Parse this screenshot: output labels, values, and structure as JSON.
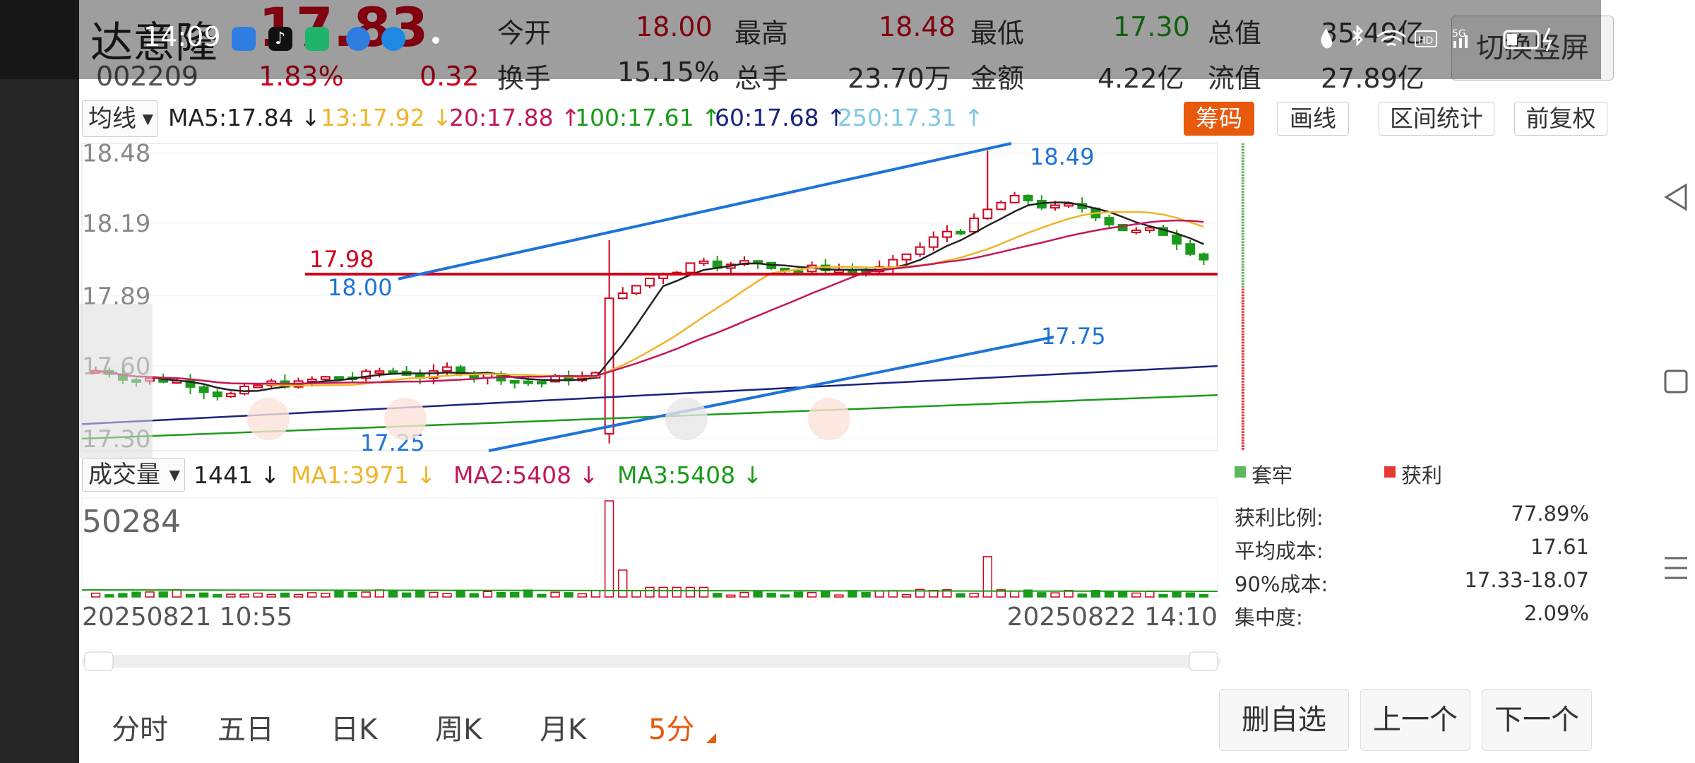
{
  "status_bar": {
    "time": "14:09"
  },
  "header": {
    "stock_name": "达意隆",
    "price": "17.83",
    "code": "002209",
    "change_pct": "1.83%",
    "change": "0.32",
    "fields": [
      {
        "label": "今开",
        "value": "18.00",
        "color": "#d0021b"
      },
      {
        "label": "最高",
        "value": "18.48",
        "color": "#d0021b"
      },
      {
        "label": "最低",
        "value": "17.30",
        "color": "#1a9b1a"
      },
      {
        "label": "总值",
        "value": "35.49亿",
        "color": "#333333"
      },
      {
        "label": "换手",
        "value": "15.15%",
        "color": "#333333"
      },
      {
        "label": "总手",
        "value": "23.70万",
        "color": "#333333"
      },
      {
        "label": "金额",
        "value": "4.22亿",
        "color": "#333333"
      },
      {
        "label": "流值",
        "value": "27.89亿",
        "color": "#333333"
      }
    ],
    "switch_button": "切换竖屏"
  },
  "ma_bar": {
    "selector": "均线",
    "items": [
      {
        "text": "MA5:17.84",
        "arrow": "↓",
        "color": "#222222"
      },
      {
        "text": "13:17.92",
        "arrow": "↓",
        "color": "#f0b429"
      },
      {
        "text": "20:17.88",
        "arrow": "↑",
        "color": "#c2185b"
      },
      {
        "text": "100:17.61",
        "arrow": "↑",
        "color": "#1a9b1a"
      },
      {
        "text": "60:17.68",
        "arrow": "↑",
        "color": "#1a237e"
      },
      {
        "text": "250:17.31",
        "arrow": "↑",
        "color": "#7ec8e3"
      }
    ],
    "buttons": {
      "chips": "筹码",
      "draw": "画线",
      "range": "区间统计",
      "adjust": "前复权"
    }
  },
  "chart_data": {
    "type": "candlestick",
    "y_ticks": [
      "18.48",
      "18.19",
      "17.89",
      "17.60",
      "17.30"
    ],
    "ylim": [
      17.25,
      18.52
    ],
    "annotations": {
      "line_98": "17.98",
      "line_00": "18.00",
      "high_label": "18.49",
      "low_label": "17.25",
      "mid_label": "17.75"
    },
    "volume_max_label": "50284",
    "x_start": "20250821 10:55",
    "x_end": "20250822 14:10"
  },
  "volume_bar": {
    "selector": "成交量",
    "value": "1441",
    "ma1": "MA1:3971",
    "ma2": "MA2:5408",
    "ma3": "MA3:5408"
  },
  "chips": {
    "legend_trapped": "套牢",
    "legend_profit": "获利",
    "stats": [
      {
        "label": "获利比例:",
        "value": "77.89%"
      },
      {
        "label": "平均成本:",
        "value": "17.61"
      },
      {
        "label": "90%成本:",
        "value": "17.33-18.07"
      },
      {
        "label": "集中度:",
        "value": "2.09%"
      }
    ]
  },
  "period_tabs": [
    "分时",
    "五日",
    "日K",
    "周K",
    "月K",
    "5分"
  ],
  "active_tab": "5分",
  "bottom_buttons": {
    "remove": "删自选",
    "prev": "上一个",
    "next": "下一个"
  },
  "colors": {
    "up": "#d0021b",
    "down": "#1a9b1a",
    "accent": "#e8590c",
    "trend": "#1e73d8"
  }
}
